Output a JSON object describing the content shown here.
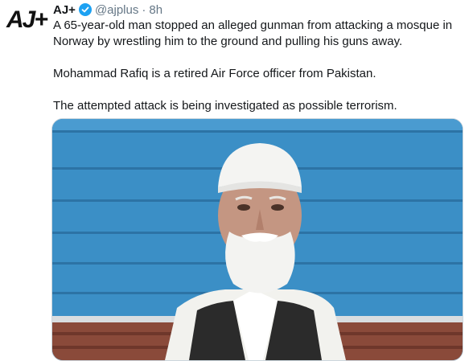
{
  "tweet": {
    "author_name": "AJ+",
    "handle": "@ajplus",
    "separator": "·",
    "time": "8h",
    "avatar_text": "AJ+",
    "paragraphs": [
      "A 65-year-old man stopped an alleged gunman from attacking a mosque in Norway by wrestling him to the ground and pulling his guns away.",
      "Mohammad Rafiq is a retired Air Force officer from Pakistan.",
      "The attempted attack is being investigated as possible terrorism."
    ]
  },
  "colors": {
    "text": "#14171a",
    "muted": "#657786",
    "verified": "#1da1f2",
    "background_wall": "#3a8ec4"
  },
  "icons": {
    "verified": "verified-badge-icon"
  }
}
